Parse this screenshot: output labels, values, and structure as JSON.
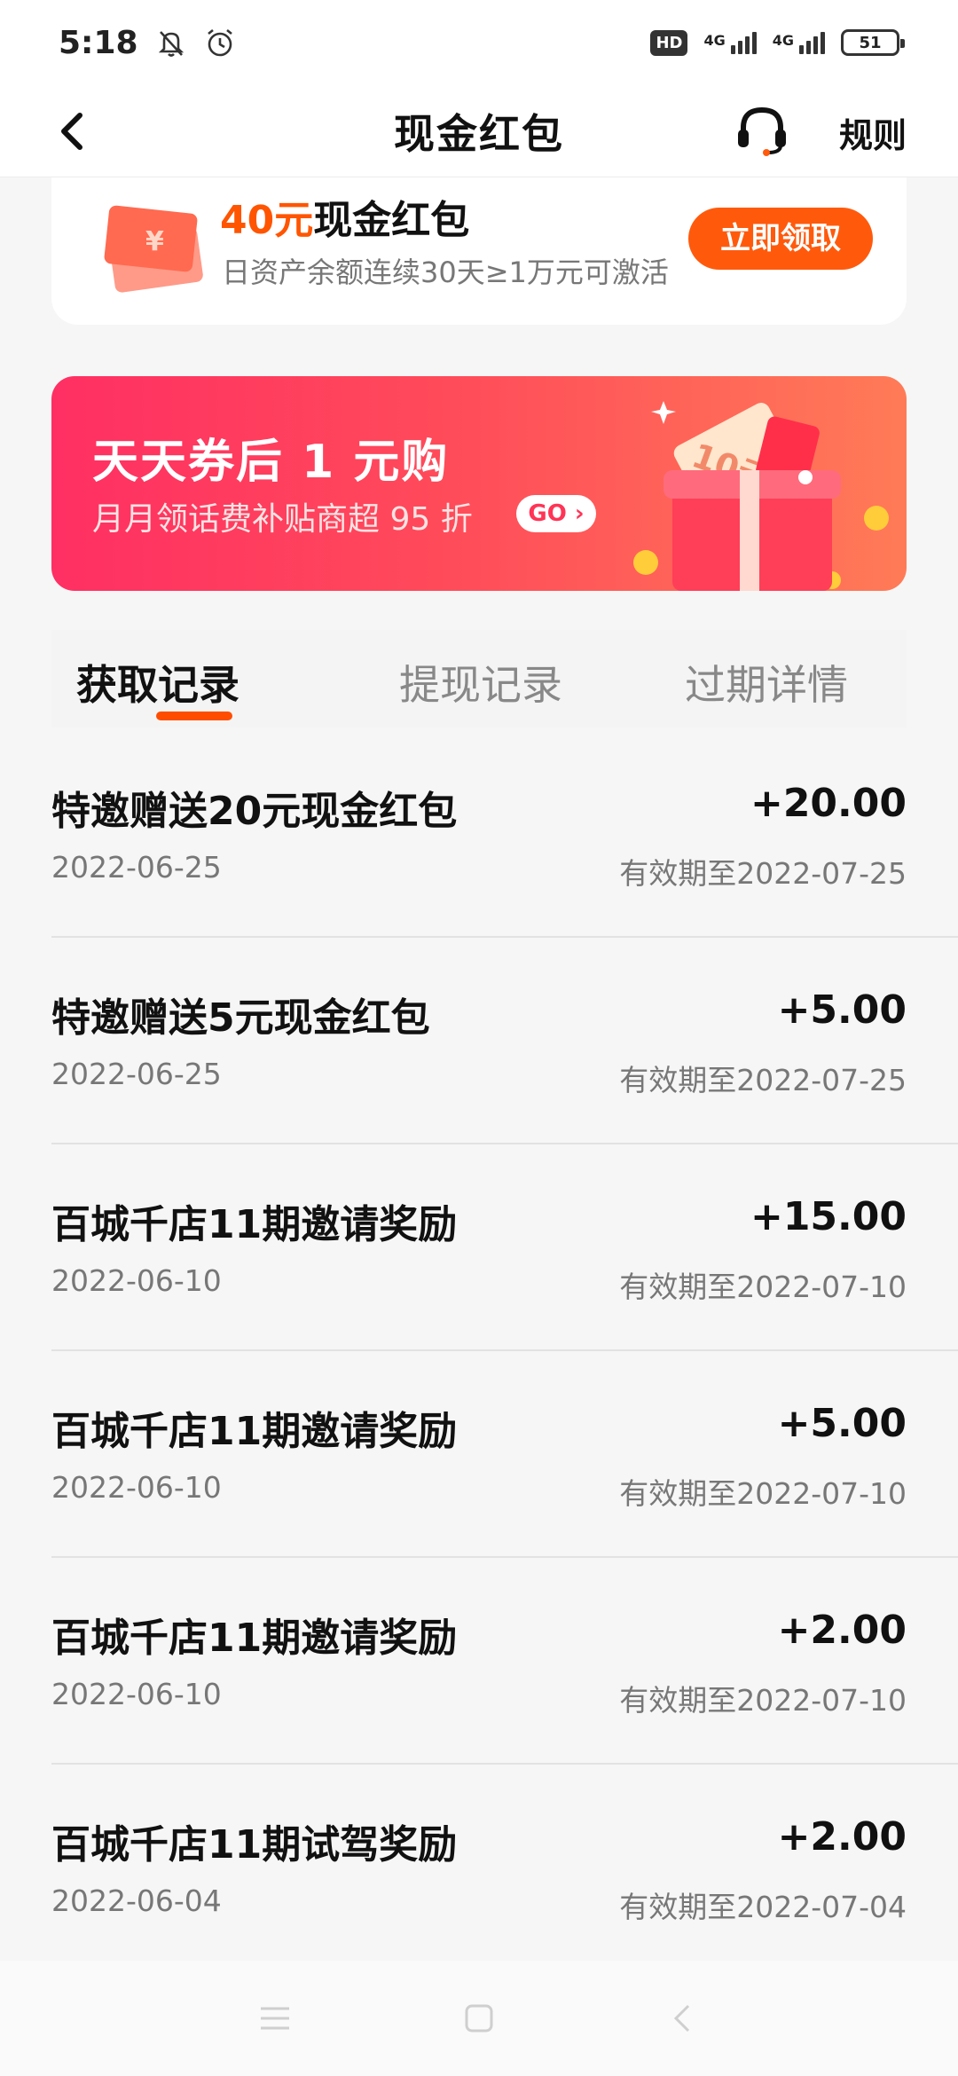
{
  "status_bar": {
    "time": "5:18",
    "net1_label": "4G",
    "net2_label": "4G",
    "hd_label": "HD",
    "battery": "51"
  },
  "nav": {
    "title": "现金红包",
    "rules": "规则"
  },
  "promo": {
    "amount": "40元",
    "title_rest": "现金红包",
    "subtitle": "日资产余额连续30天≥1万元可激活",
    "button": "立即领取",
    "accent": "#ff5a0c"
  },
  "banner": {
    "title": "天天券后 1 元购",
    "subtitle": "月月领话费补贴商超 95 折",
    "go_label": "GO",
    "ticket_text": "10元"
  },
  "tabs": [
    {
      "label": "获取记录",
      "active": true
    },
    {
      "label": "提现记录",
      "active": false
    },
    {
      "label": "过期详情",
      "active": false
    }
  ],
  "records": [
    {
      "title": "特邀赠送20元现金红包",
      "date": "2022-06-25",
      "amount": "+20.00",
      "expiry": "有效期至2022-07-25"
    },
    {
      "title": "特邀赠送5元现金红包",
      "date": "2022-06-25",
      "amount": "+5.00",
      "expiry": "有效期至2022-07-25"
    },
    {
      "title": "百城千店11期邀请奖励",
      "date": "2022-06-10",
      "amount": "+15.00",
      "expiry": "有效期至2022-07-10"
    },
    {
      "title": "百城千店11期邀请奖励",
      "date": "2022-06-10",
      "amount": "+5.00",
      "expiry": "有效期至2022-07-10"
    },
    {
      "title": "百城千店11期邀请奖励",
      "date": "2022-06-10",
      "amount": "+2.00",
      "expiry": "有效期至2022-07-10"
    },
    {
      "title": "百城千店11期试驾奖励",
      "date": "2022-06-04",
      "amount": "+2.00",
      "expiry": "有效期至2022-07-04"
    }
  ]
}
